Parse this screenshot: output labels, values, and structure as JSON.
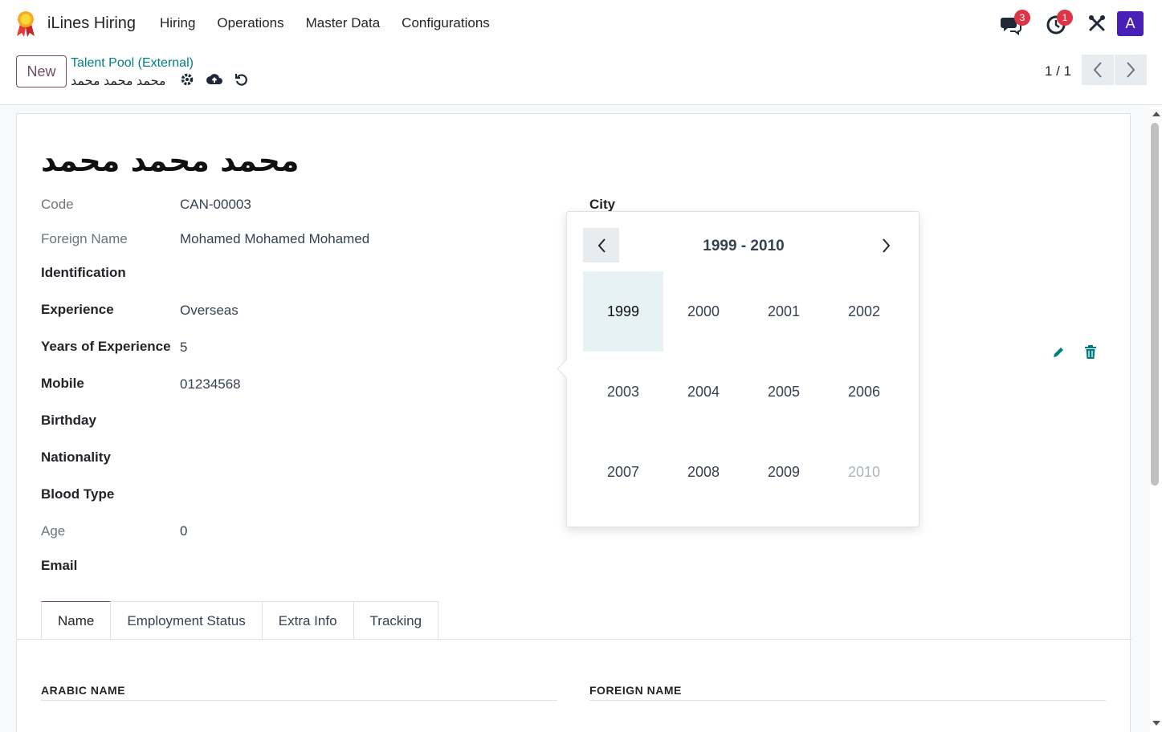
{
  "app": {
    "name": "iLines Hiring"
  },
  "menu": [
    "Hiring",
    "Operations",
    "Master Data",
    "Configurations"
  ],
  "systray": {
    "messages_count": "3",
    "activities_count": "1",
    "avatar_letter": "A"
  },
  "control_panel": {
    "new_label": "New",
    "breadcrumb_parent": "Talent Pool (External)",
    "breadcrumb_current": "محمد محمد محمد",
    "pager_value": "1 / 1"
  },
  "record": {
    "title": "محمد محمد محمد",
    "fields": [
      {
        "label": "Code",
        "value": "CAN-00003",
        "style": "light"
      },
      {
        "label": "Foreign Name",
        "value": "Mohamed Mohamed Mohamed",
        "style": "light"
      },
      {
        "label": "Identification",
        "value": "",
        "style": "bold"
      },
      {
        "label": "Experience",
        "value": "Overseas",
        "style": "bold"
      },
      {
        "label": "Years of Experience",
        "value": "5",
        "style": "bold"
      },
      {
        "label": "Mobile",
        "value": "01234568",
        "style": "bold"
      },
      {
        "label": "Birthday",
        "value": "",
        "style": "bold"
      },
      {
        "label": "Nationality",
        "value": "",
        "style": "bold"
      },
      {
        "label": "Blood Type",
        "value": "",
        "style": "bold"
      },
      {
        "label": "Age",
        "value": "0",
        "style": "light"
      },
      {
        "label": "Email",
        "value": "",
        "style": "bold"
      }
    ],
    "city_label": "City"
  },
  "tabs": [
    "Name",
    "Employment Status",
    "Extra Info",
    "Tracking"
  ],
  "sections": {
    "left": "ARABIC NAME",
    "right": "FOREIGN NAME"
  },
  "picker": {
    "range_title": "1999 - 2010",
    "years": [
      "1999",
      "2000",
      "2001",
      "2002",
      "2003",
      "2004",
      "2005",
      "2006",
      "2007",
      "2008",
      "2009",
      "2010"
    ],
    "selected": "1999",
    "muted": "2010"
  }
}
